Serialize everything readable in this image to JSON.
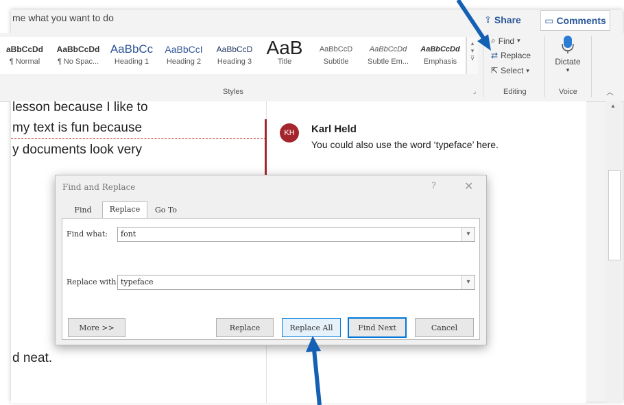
{
  "topbar": {
    "tell_me": "me what you want to do",
    "share": "Share",
    "comments": "Comments"
  },
  "ribbon": {
    "styles": [
      {
        "sample": "aBbCcDd",
        "name": "¶ Normal"
      },
      {
        "sample": "AaBbCcDd",
        "name": "¶ No Spac..."
      },
      {
        "sample": "AaBbCc",
        "name": "Heading 1"
      },
      {
        "sample": "AaBbCcI",
        "name": "Heading 2"
      },
      {
        "sample": "AaBbCcD",
        "name": "Heading 3"
      },
      {
        "sample": "AaB",
        "name": "Title"
      },
      {
        "sample": "AaBbCcD",
        "name": "Subtitle"
      },
      {
        "sample": "AaBbCcDd",
        "name": "Subtle Em..."
      },
      {
        "sample": "AaBbCcDd",
        "name": "Emphasis"
      }
    ],
    "styles_label": "Styles",
    "editing": {
      "find": "Find",
      "replace": "Replace",
      "select": "Select",
      "label": "Editing"
    },
    "voice": {
      "dictate": "Dictate",
      "label": "Voice"
    }
  },
  "document": {
    "lines": [
      " lesson because I like to",
      " my text is fun because",
      "y documents look very",
      "d neat."
    ]
  },
  "comment": {
    "initials": "KH",
    "author": "Karl Held",
    "text": "You could also use the word ‘typeface’ here."
  },
  "dialog": {
    "title": "Find and Replace",
    "help": "?",
    "tabs": [
      "Find",
      "Replace",
      "Go To"
    ],
    "active_tab": "Replace",
    "find_label": "Find what:",
    "find_value": "font",
    "replace_label": "Replace with:",
    "replace_value": "typeface",
    "buttons": {
      "more": "More >>",
      "replace": "Replace",
      "replace_all": "Replace All",
      "find_next": "Find Next",
      "cancel": "Cancel"
    }
  },
  "colors": {
    "accent": "#2b579a",
    "comment_bar": "#a4262c",
    "arrow": "#1460b4",
    "focus": "#0078d7"
  }
}
